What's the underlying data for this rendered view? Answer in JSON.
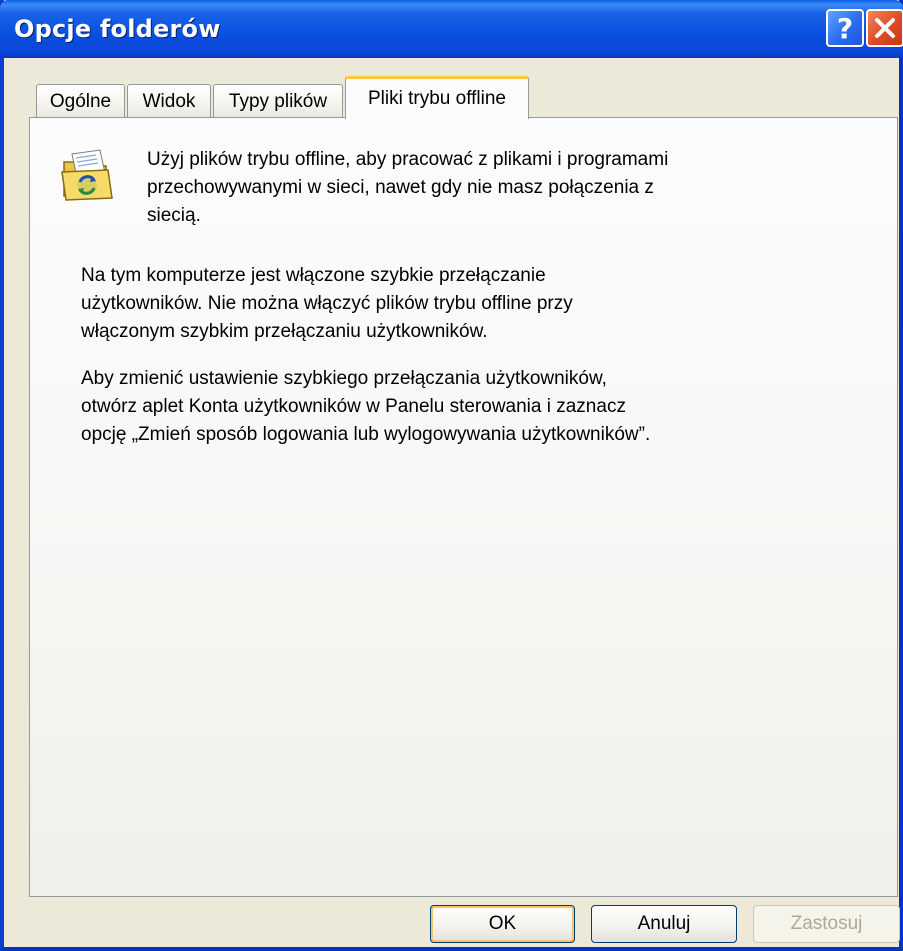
{
  "window": {
    "title": "Opcje folderów",
    "help_symbol": "?",
    "close_symbol": "X"
  },
  "tabs": [
    {
      "label": "Ogólne",
      "active": false
    },
    {
      "label": "Widok",
      "active": false
    },
    {
      "label": "Typy plików",
      "active": false
    },
    {
      "label": "Pliki trybu offline",
      "active": true
    }
  ],
  "panel": {
    "icon": "offline-files-folder-icon",
    "intro": "Użyj plików trybu offline, aby pracować z plikami i programami\nprzechowywanymi w sieci, nawet gdy nie masz połączenia z\nsiecią.",
    "paragraph1": "Na tym komputerze jest włączone szybkie przełączanie\nużytkowników. Nie można włączyć plików trybu offline przy\nwłączonym szybkim przełączaniu użytkowników.",
    "paragraph2": "Aby zmienić ustawienie szybkiego przełączania użytkowników,\notwórz aplet Konta użytkowników w Panelu sterowania i zaznacz\nopcję „Zmień sposób logowania lub wylogowywania użytkowników”."
  },
  "buttons": {
    "ok": "OK",
    "cancel": "Anuluj",
    "apply": "Zastosuj",
    "apply_enabled": false
  },
  "colors": {
    "titlebar": "#0A46D6",
    "dialog_bg": "#ECE9D8",
    "active_tab_accent": "#FFC83C",
    "close_button": "#DE4A24"
  }
}
